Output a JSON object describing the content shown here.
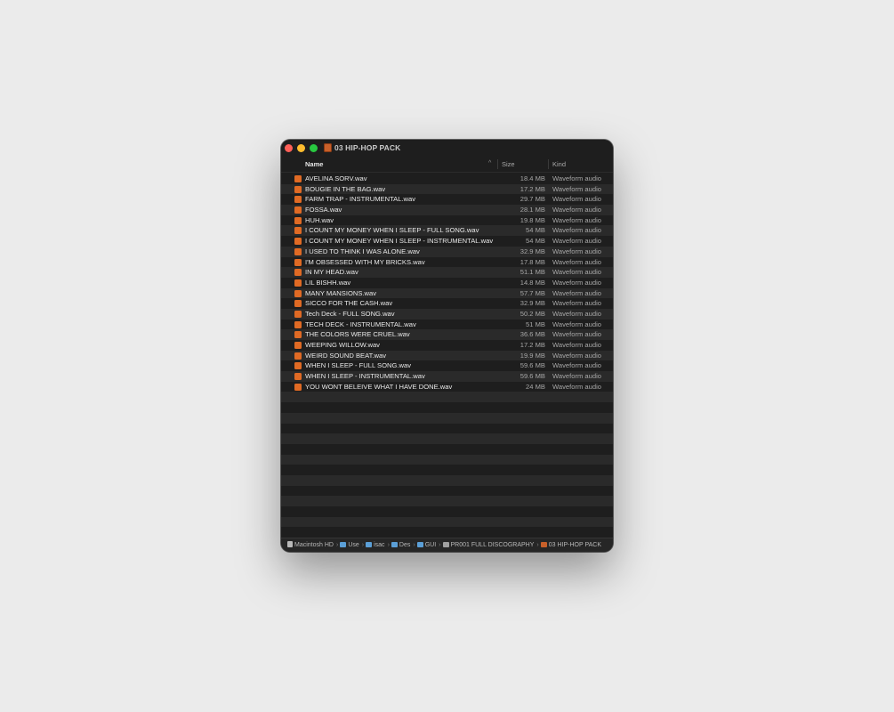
{
  "window": {
    "title": "03 HIP-HOP PACK"
  },
  "columns": {
    "name": "Name",
    "size": "Size",
    "kind": "Kind"
  },
  "files": [
    {
      "name": "AVELINA SORV.wav",
      "size": "18.4 MB",
      "kind": "Waveform audio"
    },
    {
      "name": "BOUGIE IN THE BAG.wav",
      "size": "17.2 MB",
      "kind": "Waveform audio"
    },
    {
      "name": "FARM TRAP - INSTRUMENTAL.wav",
      "size": "29.7 MB",
      "kind": "Waveform audio"
    },
    {
      "name": "FOSSA.wav",
      "size": "28.1 MB",
      "kind": "Waveform audio"
    },
    {
      "name": "HUH.wav",
      "size": "19.8 MB",
      "kind": "Waveform audio"
    },
    {
      "name": "I COUNT MY MONEY WHEN I SLEEP - FULL SONG.wav",
      "size": "54 MB",
      "kind": "Waveform audio"
    },
    {
      "name": "I COUNT MY MONEY WHEN I SLEEP - INSTRUMENTAL.wav",
      "size": "54 MB",
      "kind": "Waveform audio"
    },
    {
      "name": "I USED TO THINK I WAS ALONE.wav",
      "size": "32.9 MB",
      "kind": "Waveform audio"
    },
    {
      "name": "I'M OBSESSED WITH MY BRICKS.wav",
      "size": "17.8 MB",
      "kind": "Waveform audio"
    },
    {
      "name": "IN MY HEAD.wav",
      "size": "51.1 MB",
      "kind": "Waveform audio"
    },
    {
      "name": "LIL BISHH.wav",
      "size": "14.8 MB",
      "kind": "Waveform audio"
    },
    {
      "name": "MANY MANSIONS.wav",
      "size": "57.7 MB",
      "kind": "Waveform audio"
    },
    {
      "name": "SICCO FOR THE CASH.wav",
      "size": "32.9 MB",
      "kind": "Waveform audio"
    },
    {
      "name": "Tech Deck - FULL SONG.wav",
      "size": "50.2 MB",
      "kind": "Waveform audio"
    },
    {
      "name": "TECH DECK - INSTRUMENTAL.wav",
      "size": "51 MB",
      "kind": "Waveform audio"
    },
    {
      "name": "THE COLORS WERE CRUEL.wav",
      "size": "36.6 MB",
      "kind": "Waveform audio"
    },
    {
      "name": "WEEPING WILLOW.wav",
      "size": "17.2 MB",
      "kind": "Waveform audio"
    },
    {
      "name": "WEIRD SOUND BEAT.wav",
      "size": "19.9 MB",
      "kind": "Waveform audio"
    },
    {
      "name": "WHEN I SLEEP - FULL SONG.wav",
      "size": "59.6 MB",
      "kind": "Waveform audio"
    },
    {
      "name": "WHEN I SLEEP - INSTRUMENTAL.wav",
      "size": "59.6 MB",
      "kind": "Waveform audio"
    },
    {
      "name": "YOU WONT BELEIVE WHAT I HAVE DONE.wav",
      "size": "24 MB",
      "kind": "Waveform audio"
    }
  ],
  "empty_rows": 14,
  "pathbar": [
    {
      "label": "Macintosh HD",
      "icon": "drive-icon"
    },
    {
      "label": "Use",
      "icon": "folder-icon"
    },
    {
      "label": "isac",
      "icon": "folder-icon"
    },
    {
      "label": "Des",
      "icon": "folder-icon"
    },
    {
      "label": "GUI",
      "icon": "folder-icon"
    },
    {
      "label": "PR001 FULL DISCOGRAPHY",
      "icon": "folder-plain-icon"
    },
    {
      "label": "03 HIP-HOP PACK",
      "icon": "pack-icon"
    }
  ],
  "icons": {
    "sort": "^",
    "chevron": "›"
  },
  "colors": {
    "close": "#fe5f57",
    "minimize": "#febc2e",
    "maximize": "#28c840",
    "file_icon": "#e06a24"
  }
}
